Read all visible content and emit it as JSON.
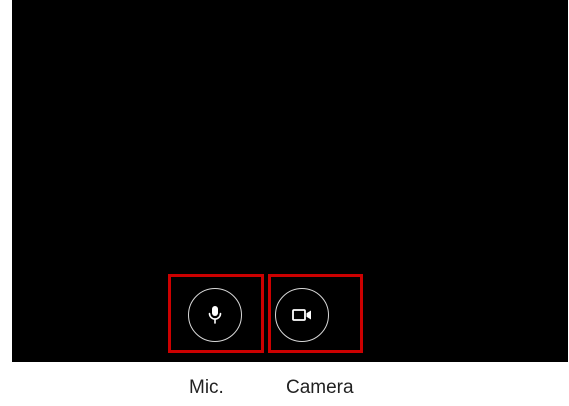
{
  "controls": {
    "mic": {
      "icon": "microphone-icon",
      "caption": "Mic."
    },
    "camera": {
      "icon": "video-camera-icon",
      "caption": "Camera"
    }
  },
  "colors": {
    "stage_background": "#000000",
    "highlight_border": "#cc0000",
    "button_ring": "#d8d8d8",
    "icon": "#ffffff",
    "caption_text": "#222222"
  }
}
